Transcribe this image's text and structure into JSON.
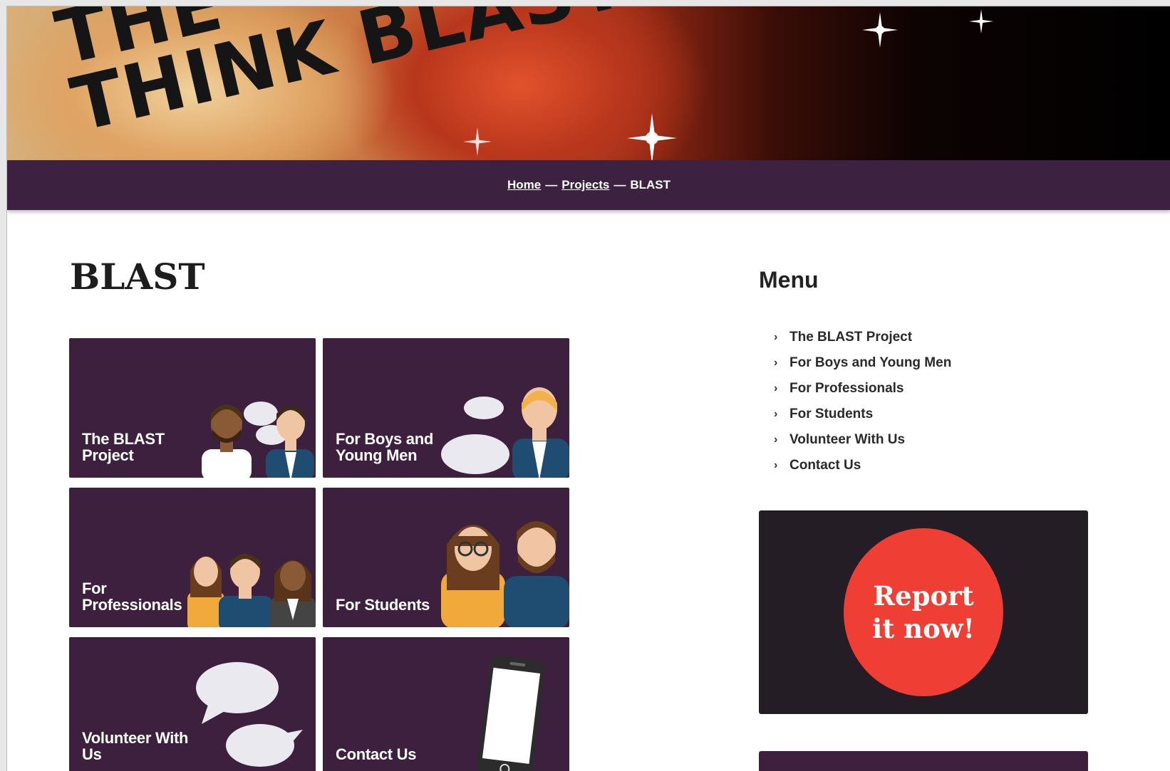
{
  "banner": {
    "line1": "THE",
    "line2": "THINK BLAST"
  },
  "breadcrumb": {
    "home": "Home",
    "projects": "Projects",
    "separator": "—",
    "current": "BLAST"
  },
  "page_title": "BLAST",
  "tiles": [
    {
      "label": "The BLAST Project",
      "icon": "two-people-talking"
    },
    {
      "label": "For Boys and Young Men",
      "icon": "boy-with-speech-bubbles"
    },
    {
      "label": "For Professionals",
      "icon": "three-professionals"
    },
    {
      "label": "For Students",
      "icon": "two-students"
    },
    {
      "label": "Volunteer With Us",
      "icon": "speech-bubbles"
    },
    {
      "label": "Contact Us",
      "icon": "mobile-phone"
    }
  ],
  "sidebar": {
    "menu_title": "Menu",
    "items": [
      {
        "label": "The BLAST Project"
      },
      {
        "label": "For Boys and Young Men"
      },
      {
        "label": "For Professionals"
      },
      {
        "label": "For Students"
      },
      {
        "label": "Volunteer With Us"
      },
      {
        "label": "Contact Us"
      }
    ],
    "report": {
      "line1": "Report",
      "line2": "it now!"
    }
  },
  "colors": {
    "purple": "#3d1f3e",
    "dark_box": "#241d25",
    "report_red": "#ef3e33"
  }
}
